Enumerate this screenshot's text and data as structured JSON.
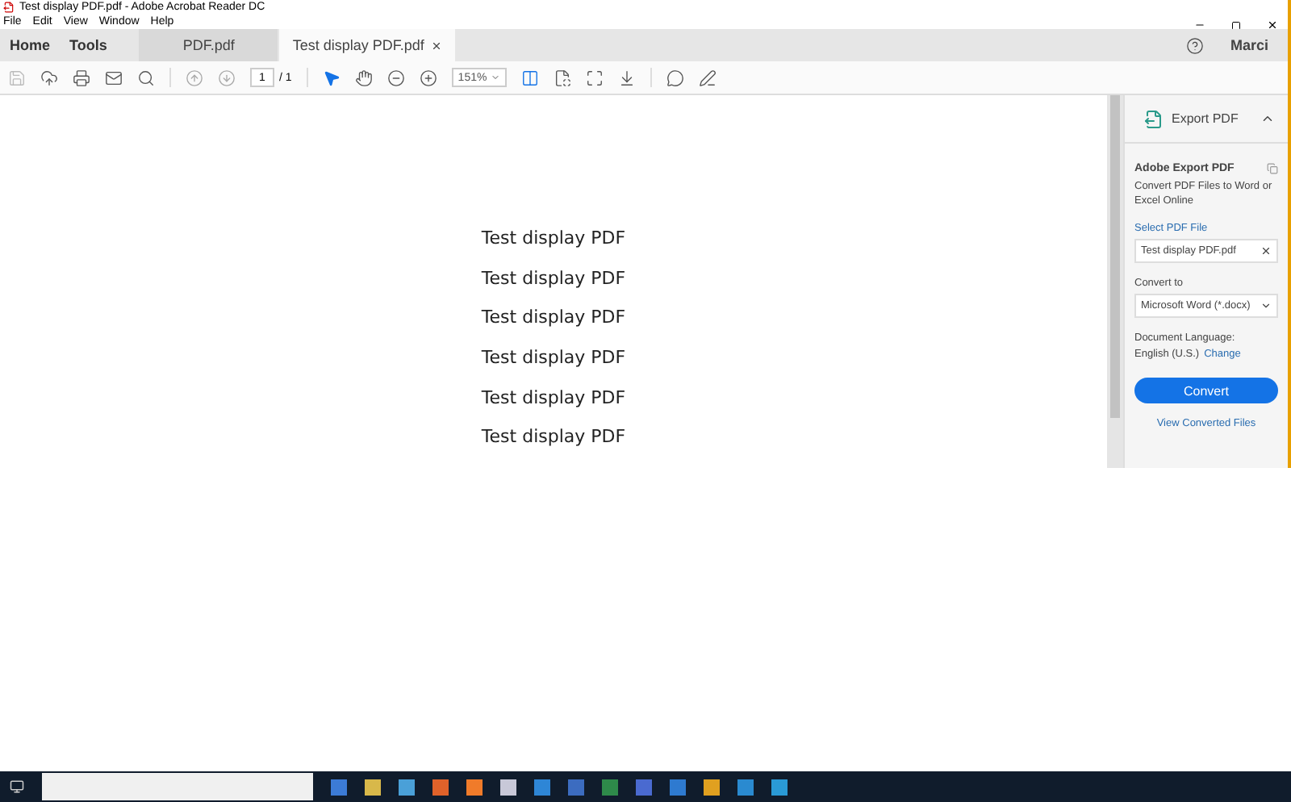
{
  "window": {
    "title": "Test display PDF.pdf - Adobe Acrobat Reader DC"
  },
  "menu": [
    "File",
    "Edit",
    "View",
    "Window",
    "Help"
  ],
  "nav": [
    "Home",
    "Tools"
  ],
  "tabs": [
    {
      "label": "PDF.pdf",
      "selected": false,
      "closable": false
    },
    {
      "label": "Test display PDF.pdf",
      "selected": true,
      "closable": true
    }
  ],
  "user": "Marci",
  "toolbar": {
    "page": "1",
    "page_total": "/ 1",
    "zoom": "151%"
  },
  "document": {
    "lines": [
      "Test display PDF",
      "Test display PDF",
      "Test display PDF",
      "Test display PDF",
      "Test display PDF",
      "Test display PDF"
    ]
  },
  "panel": {
    "header": "Export PDF",
    "expanded": true,
    "title": "Adobe Export PDF",
    "description": "Convert PDF Files to Word or Excel Online",
    "select_label": "Select PDF File",
    "file": "Test display PDF.pdf",
    "convert_label": "Convert to",
    "format": "Microsoft Word (*.docx)",
    "language_label": "Document Language:",
    "language": "English (U.S.)",
    "change_link": "Change",
    "convert_button": "Convert",
    "view_link": "View Converted Files"
  }
}
